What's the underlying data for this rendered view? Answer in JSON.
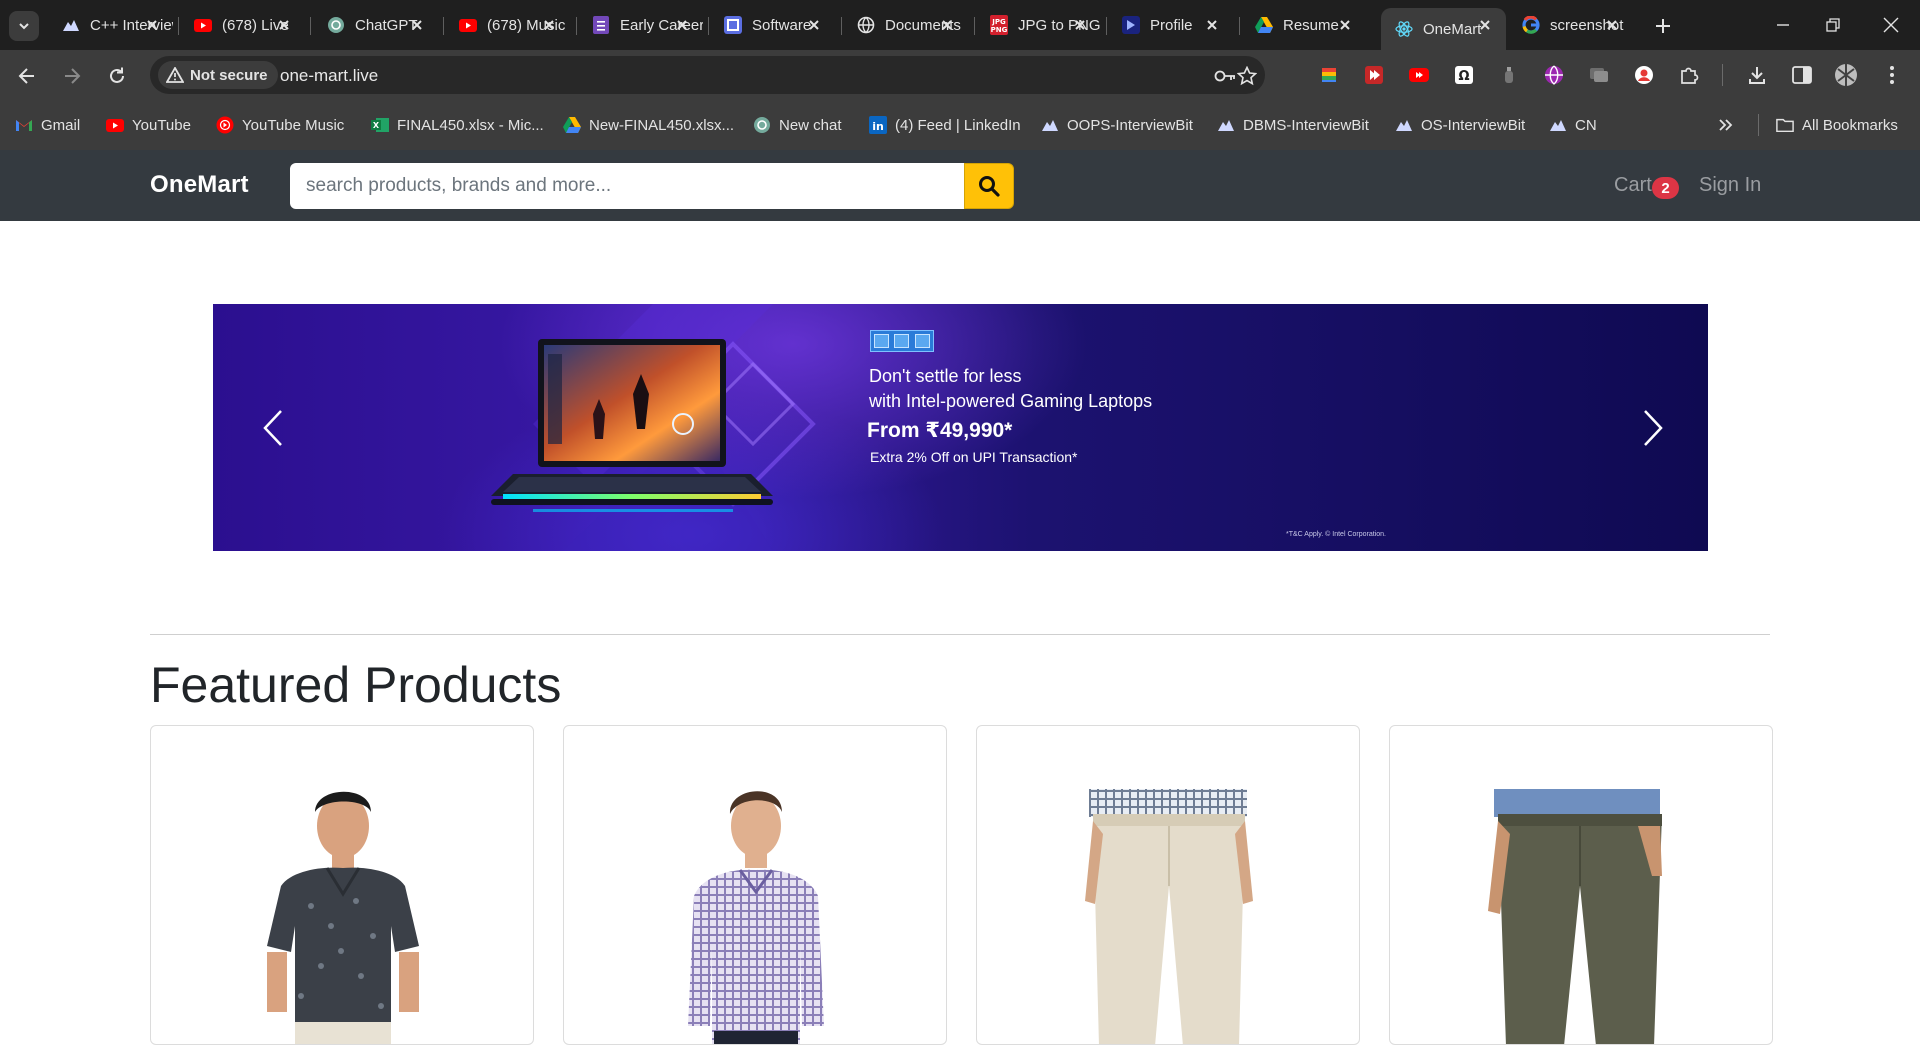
{
  "browser": {
    "tabs": [
      {
        "title": "C++ Interview",
        "icon": "interviewbit-icon"
      },
      {
        "title": "(678) Live",
        "icon": "youtube-icon"
      },
      {
        "title": "ChatGPT",
        "icon": "chatgpt-icon"
      },
      {
        "title": "(678) Music",
        "icon": "youtube-icon"
      },
      {
        "title": "Early Career",
        "icon": "forms-icon"
      },
      {
        "title": "Software",
        "icon": "app-icon"
      },
      {
        "title": "Documents",
        "icon": "globe-icon"
      },
      {
        "title": "JPG to PNG",
        "icon": "jpg-png-icon"
      },
      {
        "title": "Profile",
        "icon": "profile-icon"
      },
      {
        "title": "Resume",
        "icon": "google-drive-icon"
      },
      {
        "title": "OneMart",
        "icon": "react-icon",
        "active": true
      },
      {
        "title": "screenshot",
        "icon": "google-icon"
      }
    ],
    "security_label": "Not secure",
    "url": "one-mart.live",
    "bookmarks": [
      {
        "label": "Gmail",
        "icon": "gmail-icon"
      },
      {
        "label": "YouTube",
        "icon": "youtube-icon"
      },
      {
        "label": "YouTube Music",
        "icon": "youtube-music-icon"
      },
      {
        "label": "FINAL450.xlsx - Mic...",
        "icon": "excel-icon"
      },
      {
        "label": "New-FINAL450.xlsx...",
        "icon": "google-drive-icon"
      },
      {
        "label": "New chat",
        "icon": "chatgpt-icon"
      },
      {
        "label": "(4) Feed | LinkedIn",
        "icon": "linkedin-icon"
      },
      {
        "label": "OOPS-InterviewBit",
        "icon": "interviewbit-icon"
      },
      {
        "label": "DBMS-InterviewBit",
        "icon": "interviewbit-icon"
      },
      {
        "label": "OS-InterviewBit",
        "icon": "interviewbit-icon"
      },
      {
        "label": "CN",
        "icon": "interviewbit-icon"
      }
    ],
    "all_bookmarks_label": "All Bookmarks"
  },
  "site": {
    "brand": "OneMart",
    "search_placeholder": "search products, brands and more...",
    "cart_label": "Cart",
    "cart_count": "2",
    "signin_label": "Sign In"
  },
  "hero": {
    "line1": "Don't settle for less",
    "line2": "with Intel-powered Gaming Laptops",
    "price": "From ₹49,990*",
    "offer": "Extra 2% Off on UPI Transaction*",
    "legal": "*T&C Apply. © Intel Corporation."
  },
  "featured": {
    "title": "Featured Products",
    "products": [
      {
        "image": "man-printed-polo-shirt"
      },
      {
        "image": "man-checked-shirt"
      },
      {
        "image": "beige-chino-pants"
      },
      {
        "image": "olive-chino-pants"
      }
    ]
  },
  "colors": {
    "accent": "#ffc107",
    "navbar": "#343a40",
    "badge": "#dc3545"
  }
}
